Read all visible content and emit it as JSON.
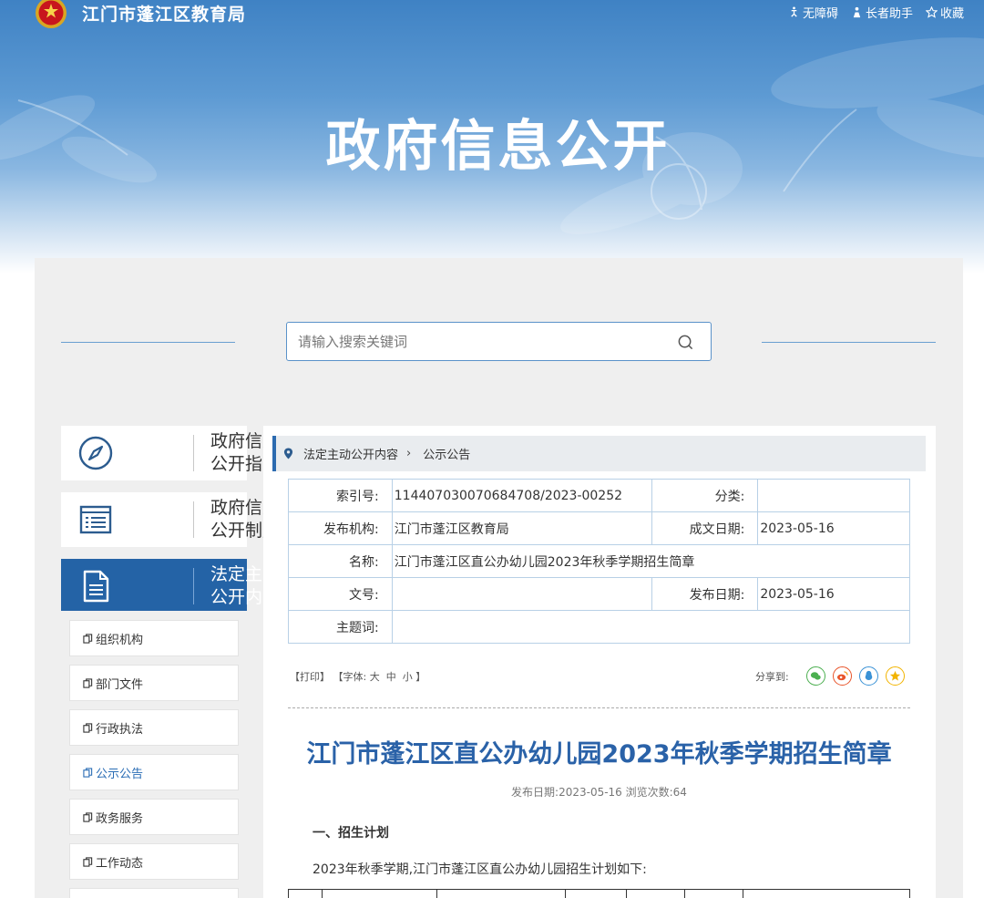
{
  "header": {
    "site_name": "江门市蓬江区教育局",
    "links": [
      {
        "label": "无障碍",
        "icon": "accessibility-icon"
      },
      {
        "label": "长者助手",
        "icon": "elder-helper-icon"
      },
      {
        "label": "收藏",
        "icon": "star-icon"
      }
    ],
    "banner_title": "政府信息公开"
  },
  "search": {
    "placeholder": "请输入搜索关键词",
    "value": ""
  },
  "sidebar": {
    "cards": [
      {
        "label": "政府信息公开指南",
        "icon": "compass-icon",
        "active": false
      },
      {
        "label": "政府信息公开制度",
        "icon": "list-document-icon",
        "active": false
      },
      {
        "label": "法定主动公开内容",
        "icon": "document-icon",
        "active": true
      }
    ],
    "sub_items": [
      {
        "label": "组织机构",
        "current": false
      },
      {
        "label": "部门文件",
        "current": false
      },
      {
        "label": "行政执法",
        "current": false
      },
      {
        "label": "公示公告",
        "current": true
      },
      {
        "label": "政务服务",
        "current": false
      },
      {
        "label": "工作动态",
        "current": false
      }
    ]
  },
  "breadcrumb": {
    "items": [
      "法定主动公开内容",
      "公示公告"
    ]
  },
  "meta": {
    "index_label": "索引号:",
    "index_value": "114407030070684708/2023-00252",
    "category_label": "分类:",
    "category_value": "",
    "publisher_label": "发布机构:",
    "publisher_value": "江门市蓬江区教育局",
    "created_label": "成文日期:",
    "created_value": "2023-05-16",
    "name_label": "名称:",
    "name_value": "江门市蓬江区直公办幼儿园2023年秋季学期招生简章",
    "docno_label": "文号:",
    "docno_value": "",
    "pubdate_label": "发布日期:",
    "pubdate_value": "2023-05-16",
    "keywords_label": "主题词:",
    "keywords_value": ""
  },
  "tools": {
    "print": "【打印】",
    "font_prefix": "【字体:",
    "font_large": "大",
    "font_medium": "中",
    "font_small": "小",
    "font_suffix": "】",
    "share_label": "分享到:",
    "share_icons": [
      "wechat-icon",
      "weibo-icon",
      "qq-icon",
      "qzone-icon"
    ]
  },
  "article": {
    "title": "江门市蓬江区直公办幼儿园2023年秋季学期招生简章",
    "meta_line": "发布日期:2023-05-16 浏览次数:64",
    "section_heading": "一、招生计划",
    "paragraph": "2023年秋季学期,江门市蓬江区直公办幼儿园招生计划如下:"
  },
  "colors": {
    "brand_blue": "#2463a6",
    "title_blue": "#2a62a8",
    "panel_gray": "#efefef"
  }
}
